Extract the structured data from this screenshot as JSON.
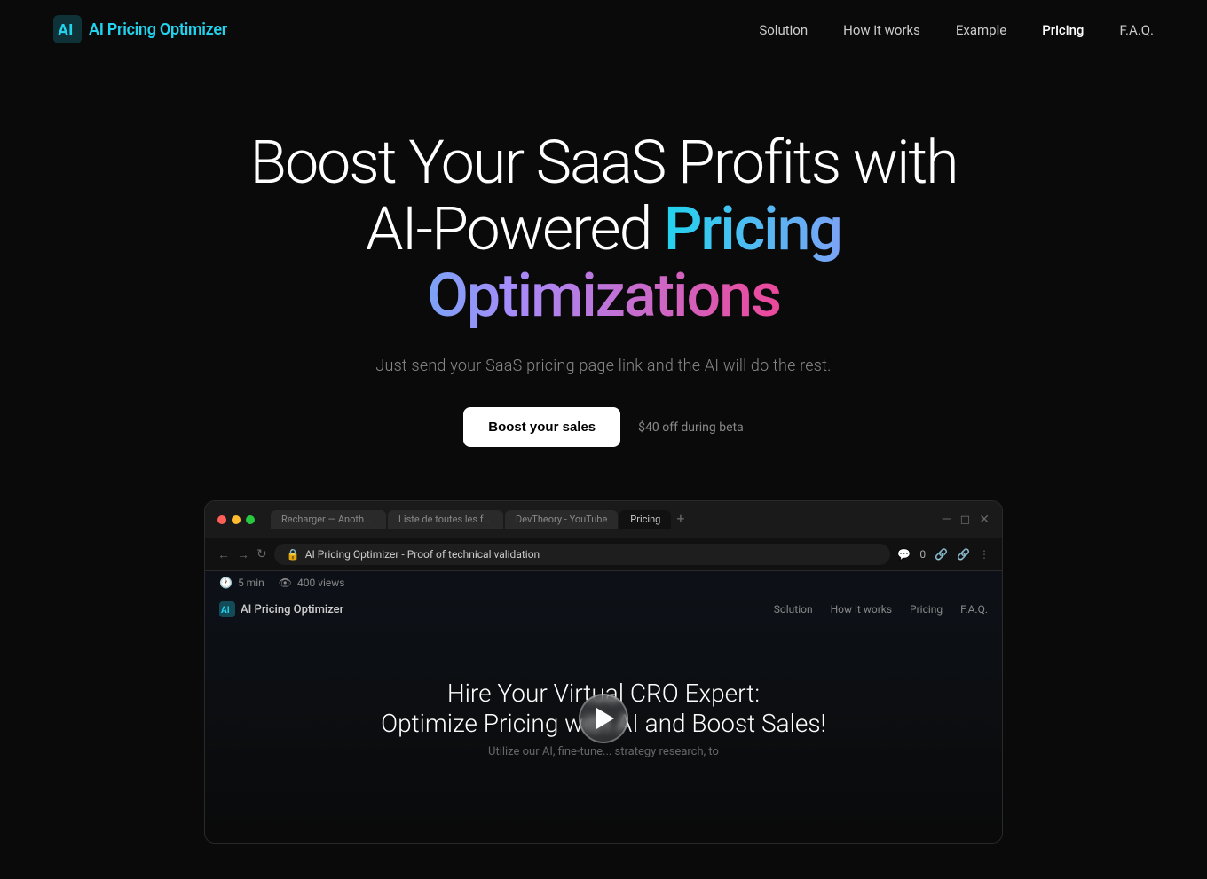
{
  "nav": {
    "logo": {
      "prefix": "AI",
      "name": "Pricing Optimizer"
    },
    "links": [
      {
        "label": "Solution",
        "href": "#",
        "active": false
      },
      {
        "label": "How it works",
        "href": "#",
        "active": false
      },
      {
        "label": "Example",
        "href": "#",
        "active": false
      },
      {
        "label": "Pricing",
        "href": "#",
        "active": true
      },
      {
        "label": "F.A.Q.",
        "href": "#",
        "active": false
      }
    ]
  },
  "hero": {
    "title_line1": "Boost Your SaaS Profits with",
    "title_line2_normal": "AI-Powered",
    "title_line2_gradient": "Pricing Optimizations",
    "subtitle": "Just send your SaaS pricing page link and the AI will do the rest.",
    "cta_button": "Boost your sales",
    "beta_text": "$40 off during beta"
  },
  "video": {
    "duration": "5 min",
    "views": "400 views",
    "tabs": [
      {
        "label": "Recharger — Another ChatG...",
        "active": false
      },
      {
        "label": "Liste de toutes les formations :",
        "active": false
      },
      {
        "label": "DevTheory - YouTube",
        "active": false
      },
      {
        "label": "Pricing",
        "active": true
      }
    ],
    "address_title": "AI Pricing Optimizer - Proof of technical validation",
    "inner_nav": {
      "logo": "AI Pricing Optimizer",
      "links": [
        "Solution",
        "How it works",
        "Pricing",
        "F.A.Q."
      ]
    },
    "main_title_line1": "Hire Your Virtual CRO Expert:",
    "main_title_line2": "Optimize Pricing with AI and Boost Sales!",
    "main_subtitle": "Utilize our AI, fine-tune... strategy research, to"
  }
}
